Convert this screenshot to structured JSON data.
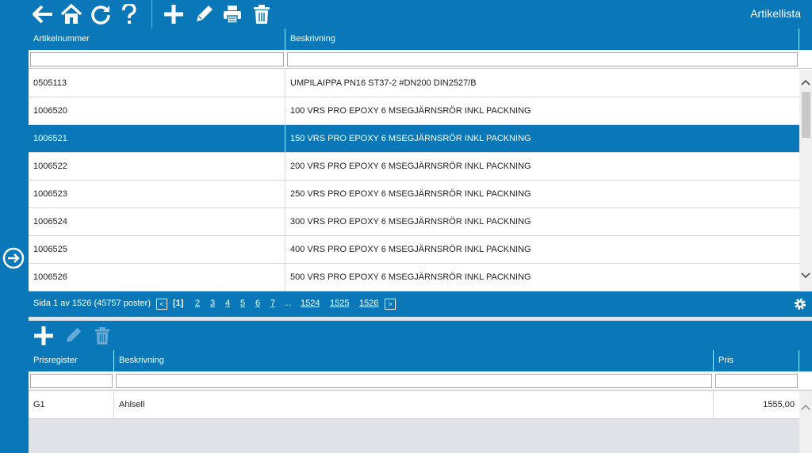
{
  "app": {
    "title": "Artikellista"
  },
  "toolbar": {
    "icons": [
      "back-icon",
      "home-icon",
      "refresh-icon",
      "help-icon",
      "add-icon",
      "edit-icon",
      "print-icon",
      "delete-icon"
    ]
  },
  "article_grid": {
    "columns": [
      "Artikelnummer",
      "Beskrivning"
    ],
    "filters": [
      "",
      ""
    ],
    "rows": [
      {
        "artnr": "0505113",
        "desc": "UMPILAIPPA PN16 ST37-2 #DN200 DIN2527/B",
        "selected": false
      },
      {
        "artnr": "1006520",
        "desc": "100 VRS PRO EPOXY 6 MSEGJÄRNSRÖR INKL PACKNING",
        "selected": false
      },
      {
        "artnr": "1006521",
        "desc": "150 VRS PRO EPOXY 6 MSEGJÄRNSRÖR INKL PACKNING",
        "selected": true
      },
      {
        "artnr": "1006522",
        "desc": "200 VRS PRO EPOXY 6 MSEGJÄRNSRÖR INKL PACKNING",
        "selected": false
      },
      {
        "artnr": "1006523",
        "desc": "250 VRS PRO EPOXY 6 MSEGJÄRNSRÖR INKL PACKNING",
        "selected": false
      },
      {
        "artnr": "1006524",
        "desc": "300 VRS PRO EPOXY 6 MSEGJÄRNSRÖR INKL PACKNING",
        "selected": false
      },
      {
        "artnr": "1006525",
        "desc": "400 VRS PRO EPOXY 6 MSEGJÄRNSRÖR INKL PACKNING",
        "selected": false
      },
      {
        "artnr": "1006526",
        "desc": "500 VRS PRO EPOXY 6 MSEGJÄRNSRÖR INKL PACKNING",
        "selected": false
      }
    ]
  },
  "pager": {
    "info": "Sida 1 av 1526 (45757 poster)",
    "current": "[1]",
    "pages": [
      "2",
      "3",
      "4",
      "5",
      "6",
      "7"
    ],
    "ellipsis": "...",
    "last_pages": [
      "1524",
      "1525",
      "1526"
    ]
  },
  "price_grid": {
    "columns": [
      "Prisregister",
      "Beskrivning",
      "Pris"
    ],
    "filters": [
      "",
      "",
      ""
    ],
    "rows": [
      {
        "register": "G1",
        "desc": "Ahlsell",
        "price": "1555,00"
      }
    ]
  },
  "colors": {
    "accent": "#0a78b8",
    "selected_row": "#0a78b8",
    "panel_bg": "#dfe3e7"
  }
}
